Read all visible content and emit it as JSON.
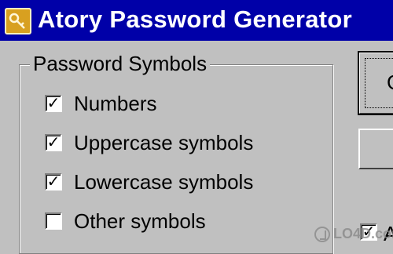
{
  "window": {
    "title": "Atory Password Generator",
    "icon": "key-icon"
  },
  "password_symbols": {
    "legend": "Password Symbols",
    "options": [
      {
        "label": "Numbers",
        "checked": true
      },
      {
        "label": "Uppercase symbols",
        "checked": true
      },
      {
        "label": "Lowercase symbols",
        "checked": true
      },
      {
        "label": "Other symbols",
        "checked": false
      }
    ]
  },
  "right_panel": {
    "top_button_label": "G",
    "bottom_check_label": "A",
    "bottom_check_checked": true
  },
  "watermark": {
    "text": "LO4D.com"
  }
}
